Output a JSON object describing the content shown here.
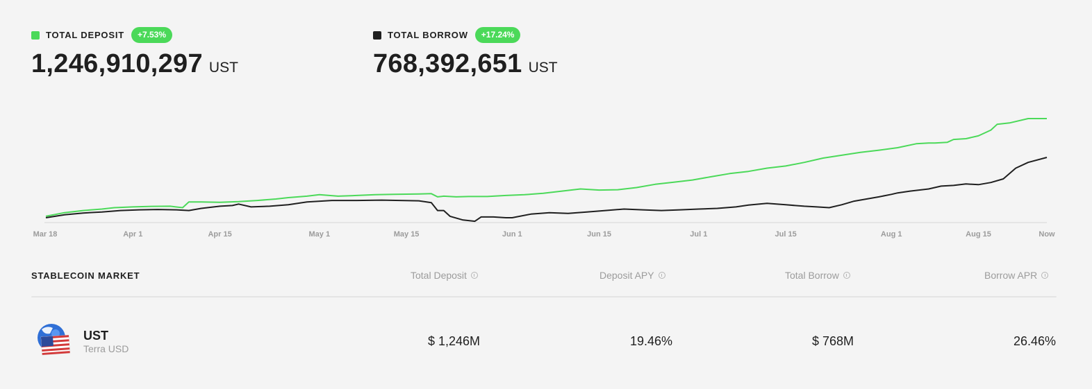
{
  "header": {
    "deposit": {
      "label": "TOTAL DEPOSIT",
      "change": "+7.53%",
      "value": "1,246,910,297",
      "unit": "UST",
      "color": "#4bd959"
    },
    "borrow": {
      "label": "TOTAL BORROW",
      "change": "+17.24%",
      "value": "768,392,651",
      "unit": "UST",
      "color": "#1f1f1f"
    }
  },
  "badge_color": "#4bd959",
  "chart_data": {
    "type": "line",
    "x_tick_labels": [
      "Mar 18",
      "Apr 1",
      "Apr 15",
      "May 1",
      "May 15",
      "Jun 1",
      "Jun 15",
      "Jul 1",
      "Jul 15",
      "Aug 1",
      "Aug 15",
      "Now"
    ],
    "x_tick_days": [
      0,
      14,
      28,
      44,
      58,
      75,
      89,
      105,
      119,
      136,
      150,
      154
    ],
    "x_range": [
      0,
      161
    ],
    "y_range": [
      0,
      1400
    ],
    "grid": false,
    "legend": "top",
    "series": [
      {
        "name": "TOTAL DEPOSIT",
        "color": "#4bd959",
        "x": [
          0,
          3,
          6,
          9,
          11,
          14,
          17,
          20,
          22,
          23,
          25,
          28,
          31,
          34,
          37,
          39,
          42,
          44,
          47,
          50,
          53,
          56,
          60,
          62,
          63,
          64,
          66,
          68,
          71,
          74,
          77,
          80,
          83,
          86,
          89,
          92,
          95,
          98,
          101,
          104,
          107,
          110,
          113,
          116,
          119,
          122,
          125,
          128,
          131,
          134,
          137,
          140,
          142,
          143,
          145,
          146,
          148,
          150,
          152,
          153,
          155,
          158,
          161
        ],
        "y": [
          30,
          80,
          110,
          130,
          150,
          160,
          168,
          170,
          150,
          230,
          230,
          225,
          235,
          250,
          270,
          290,
          310,
          330,
          310,
          320,
          330,
          335,
          340,
          345,
          300,
          310,
          300,
          305,
          305,
          320,
          330,
          350,
          380,
          410,
          395,
          400,
          430,
          475,
          505,
          535,
          580,
          625,
          655,
          700,
          730,
          780,
          840,
          880,
          920,
          950,
          985,
          1040,
          1050,
          1050,
          1060,
          1100,
          1110,
          1150,
          1230,
          1310,
          1330,
          1390,
          1390
        ]
      },
      {
        "name": "TOTAL BORROW",
        "color": "#1f1f1f",
        "x": [
          0,
          3,
          6,
          9,
          12,
          15,
          18,
          21,
          23,
          25,
          28,
          30,
          31,
          33,
          36,
          39,
          42,
          46,
          50,
          54,
          57,
          60,
          62,
          63,
          64,
          65,
          67,
          69,
          70,
          72,
          74,
          75,
          78,
          81,
          84,
          87,
          90,
          93,
          96,
          99,
          102,
          105,
          108,
          111,
          113,
          116,
          119,
          122,
          124,
          126,
          128,
          130,
          132,
          134,
          136,
          137,
          139,
          142,
          144,
          146,
          148,
          150,
          152,
          154,
          156,
          158,
          161
        ],
        "y": [
          10,
          50,
          75,
          90,
          110,
          120,
          125,
          120,
          110,
          140,
          170,
          180,
          200,
          160,
          170,
          190,
          230,
          250,
          250,
          255,
          250,
          245,
          220,
          110,
          110,
          30,
          -20,
          -40,
          20,
          20,
          10,
          10,
          60,
          80,
          70,
          90,
          110,
          130,
          120,
          110,
          120,
          130,
          140,
          160,
          185,
          210,
          190,
          170,
          160,
          150,
          190,
          240,
          270,
          300,
          335,
          355,
          380,
          410,
          450,
          460,
          480,
          470,
          500,
          550,
          700,
          780,
          850
        ]
      }
    ]
  },
  "market": {
    "title": "STABLECOIN MARKET",
    "columns": [
      "Total Deposit",
      "Deposit APY",
      "Total Borrow",
      "Borrow APR"
    ],
    "row": {
      "icon": "ust-flag-globe-icon",
      "symbol": "UST",
      "name": "Terra USD",
      "total_deposit": "$ 1,246M",
      "deposit_apy": "19.46%",
      "total_borrow": "$ 768M",
      "borrow_apr": "26.46%"
    }
  }
}
